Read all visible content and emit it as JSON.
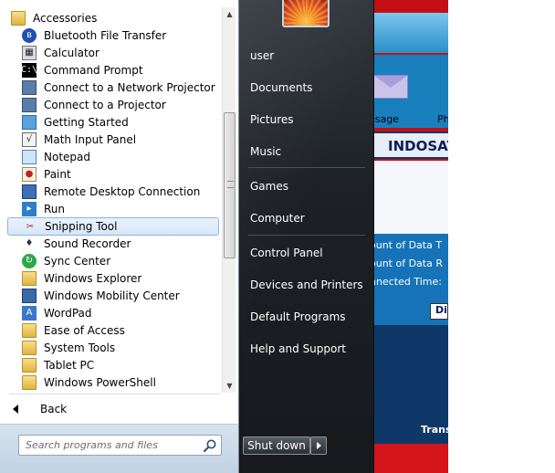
{
  "left_pane": {
    "folder_label": "Accessories",
    "items": [
      {
        "label": "Bluetooth File Transfer",
        "icon": "bluetooth-icon"
      },
      {
        "label": "Calculator",
        "icon": "calculator-icon"
      },
      {
        "label": "Command Prompt",
        "icon": "command-prompt-icon"
      },
      {
        "label": "Connect to a Network Projector",
        "icon": "network-projector-icon"
      },
      {
        "label": "Connect to a Projector",
        "icon": "projector-icon"
      },
      {
        "label": "Getting Started",
        "icon": "getting-started-icon"
      },
      {
        "label": "Math Input Panel",
        "icon": "math-input-icon"
      },
      {
        "label": "Notepad",
        "icon": "notepad-icon"
      },
      {
        "label": "Paint",
        "icon": "paint-icon"
      },
      {
        "label": "Remote Desktop Connection",
        "icon": "remote-desktop-icon"
      },
      {
        "label": "Run",
        "icon": "run-icon"
      },
      {
        "label": "Snipping Tool",
        "icon": "snipping-tool-icon",
        "selected": true
      },
      {
        "label": "Sound Recorder",
        "icon": "microphone-icon"
      },
      {
        "label": "Sync Center",
        "icon": "sync-icon"
      },
      {
        "label": "Windows Explorer",
        "icon": "explorer-folder-icon"
      },
      {
        "label": "Windows Mobility Center",
        "icon": "mobility-center-icon"
      },
      {
        "label": "WordPad",
        "icon": "wordpad-icon"
      },
      {
        "label": "Ease of Access",
        "icon": "folder-icon"
      },
      {
        "label": "System Tools",
        "icon": "folder-icon"
      },
      {
        "label": "Tablet PC",
        "icon": "folder-icon"
      },
      {
        "label": "Windows PowerShell",
        "icon": "folder-icon"
      }
    ],
    "back_label": "Back",
    "search_placeholder": "Search programs and files"
  },
  "right_pane": {
    "user": "user",
    "links_group1": [
      "Documents",
      "Pictures",
      "Music"
    ],
    "links_group2": [
      "Games",
      "Computer"
    ],
    "links_group3": [
      "Control Panel",
      "Devices and Printers",
      "Default Programs",
      "Help and Support"
    ],
    "shutdown_label": "Shut down"
  },
  "background_app": {
    "msg_label": "ssage",
    "ph_label": "Ph",
    "title": "INDOSAT",
    "info_lines": [
      "ount of Data T",
      "ount of Data R",
      "nnected Time:"
    ],
    "button_label": "Dis",
    "trans_label": "Trans"
  },
  "colors": {
    "selection_border": "#8fb3e0",
    "right_pane_bg": "#1d2126",
    "background_red": "#c40f12"
  }
}
